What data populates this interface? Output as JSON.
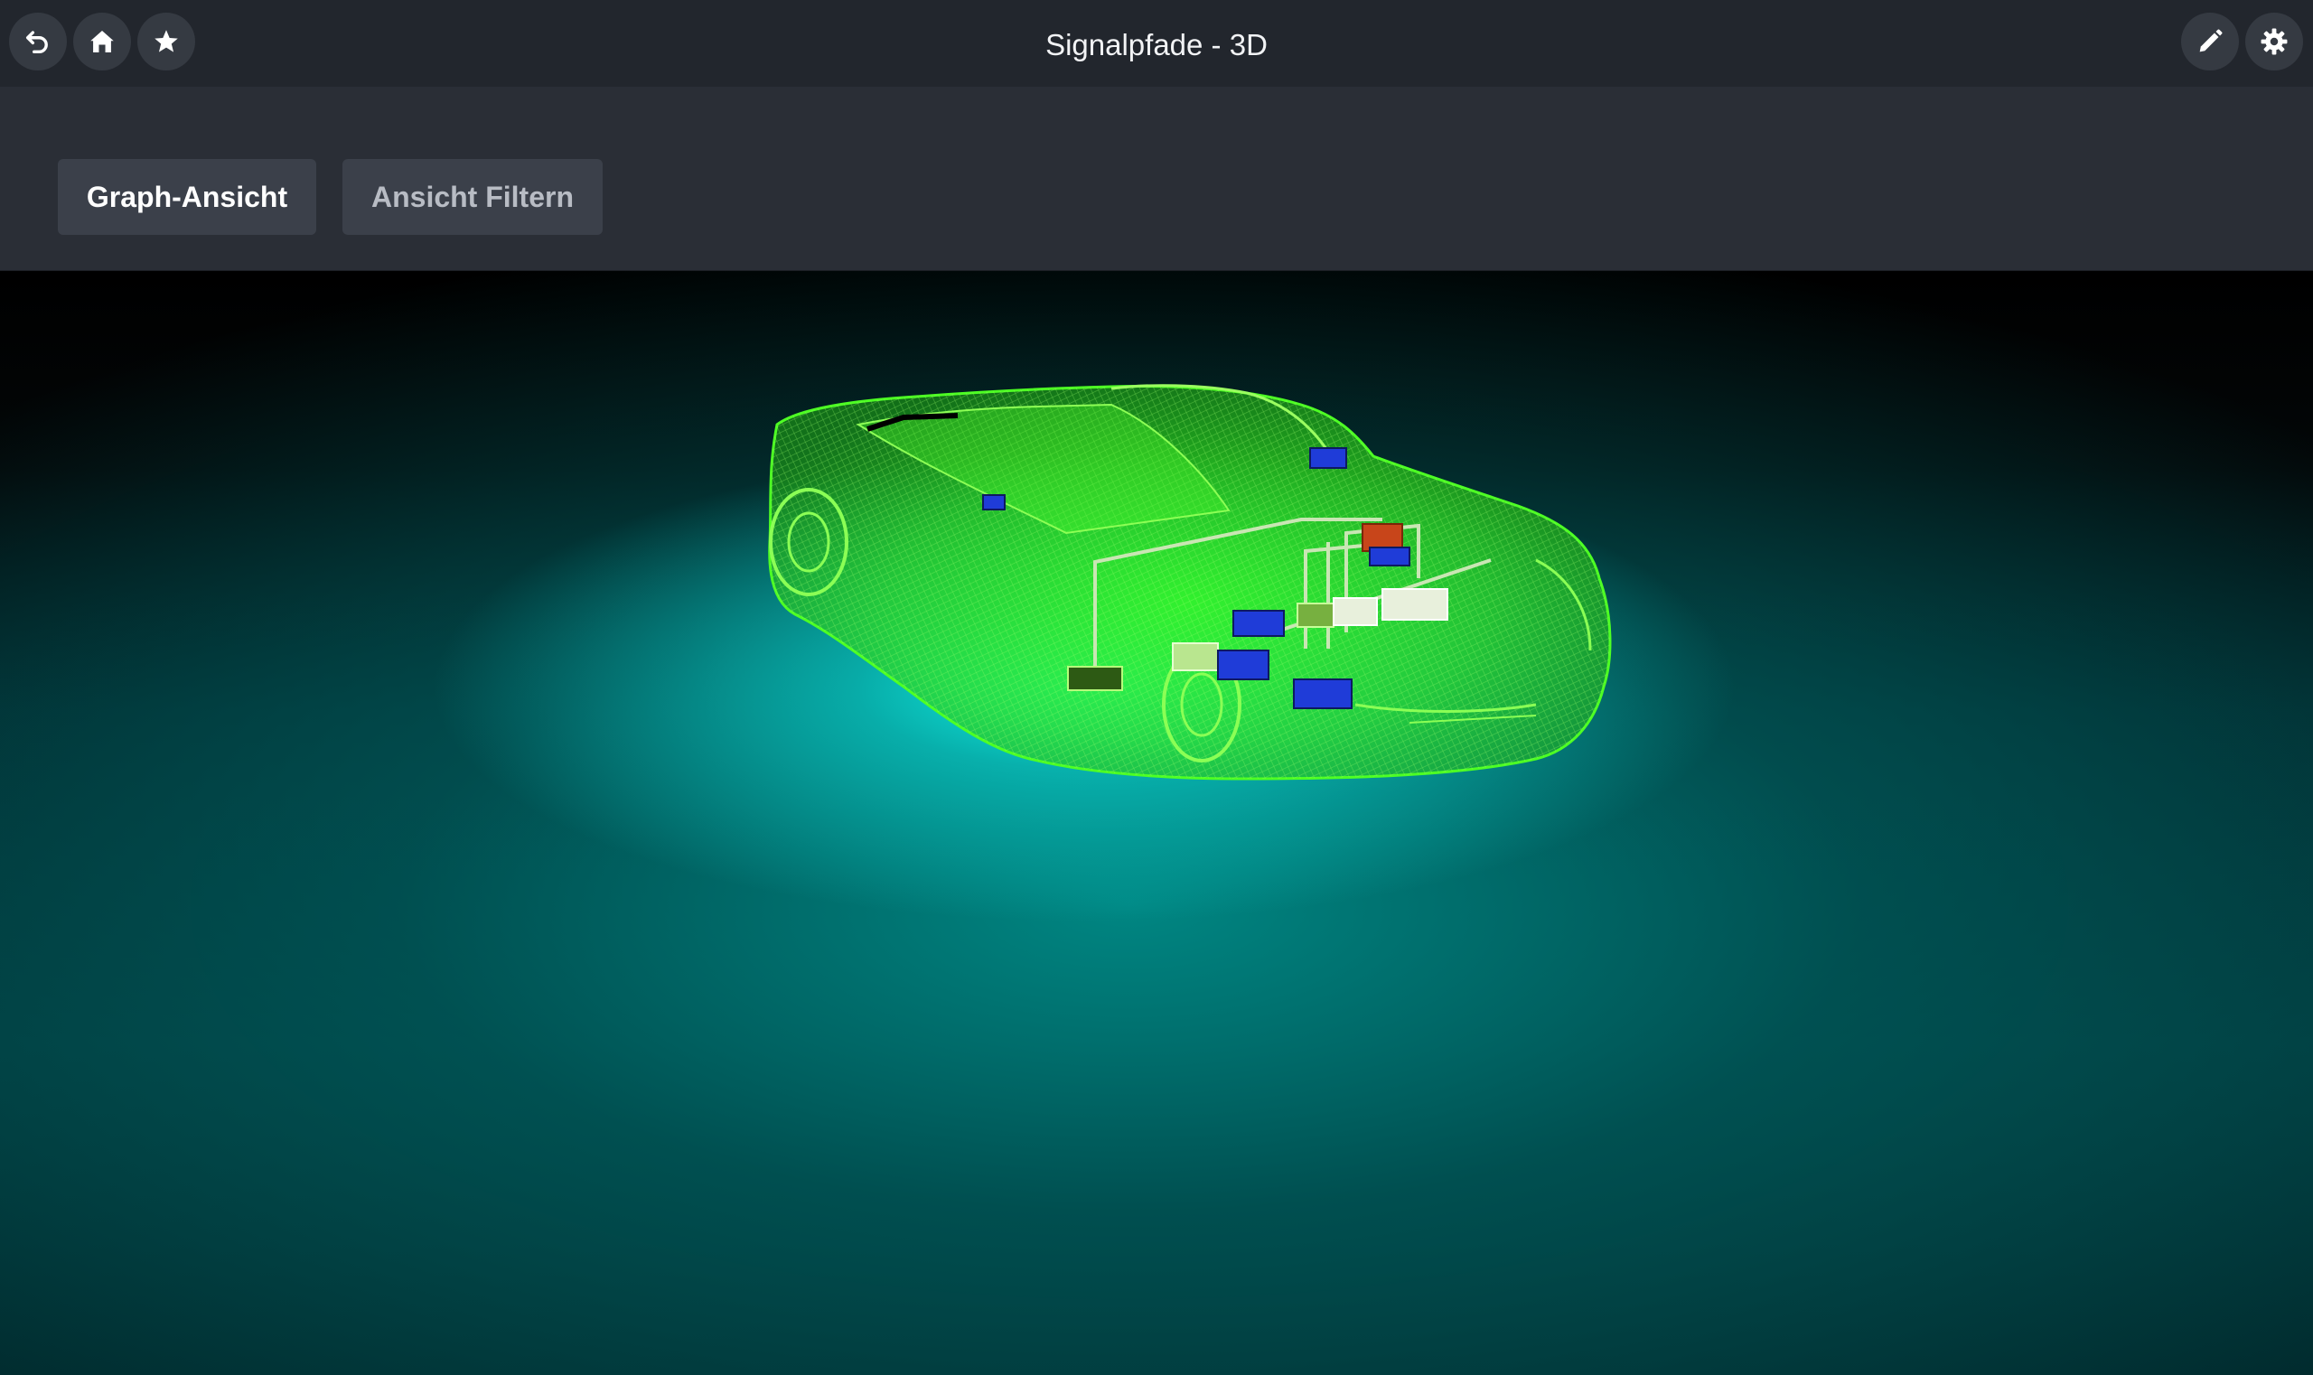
{
  "window": {
    "title": "Signalpfade - 3D"
  },
  "nav_buttons": {
    "back_icon": "undo-arrow-icon",
    "home_icon": "home-icon",
    "favorite_icon": "star-icon",
    "edit_icon": "pencil-icon",
    "settings_icon": "gear-icon"
  },
  "toolbar": {
    "graph_view_label": "Graph-Ansicht",
    "filter_view_label": "Ansicht Filtern"
  },
  "scene": {
    "model": "transparent wireframe car with signal path components",
    "colors": {
      "car_wireframe": "#3cff1e",
      "floor_glow": "#14fff0",
      "component_blue": "#1f3cd8",
      "component_red": "#c8451a",
      "component_white": "#e8f0dc"
    }
  }
}
